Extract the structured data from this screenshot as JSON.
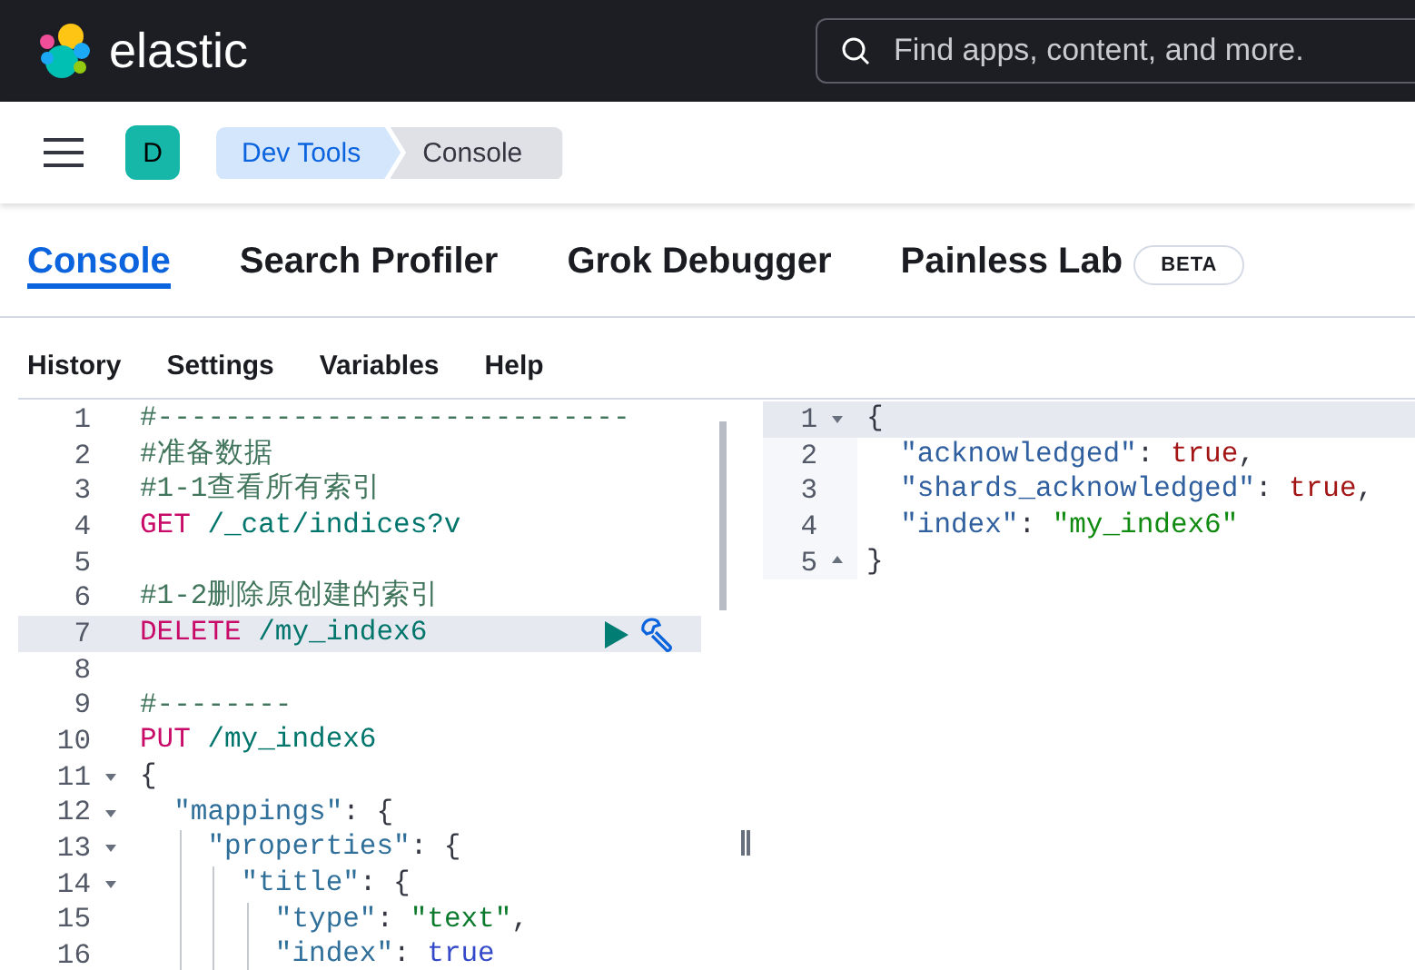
{
  "header": {
    "brand": "elastic",
    "search": {
      "placeholder": "Find apps, content, and more."
    }
  },
  "breadcrumb_bar": {
    "avatar": "D",
    "breadcrumbs": [
      {
        "label": "Dev Tools",
        "selected": false
      },
      {
        "label": "Console",
        "selected": true
      }
    ]
  },
  "tabs": [
    {
      "label": "Console",
      "selected": true
    },
    {
      "label": "Search Profiler",
      "selected": false
    },
    {
      "label": "Grok Debugger",
      "selected": false
    },
    {
      "label": "Painless Lab",
      "selected": false,
      "badge": "BETA"
    }
  ],
  "menu": [
    "History",
    "Settings",
    "Variables",
    "Help"
  ],
  "editor": {
    "lines": [
      {
        "number": "1",
        "fold_start": false,
        "fold_end": false,
        "selected": false,
        "tokens": [
          {
            "kind": "comment",
            "text": "#----------------------------"
          }
        ]
      },
      {
        "number": "2",
        "fold_start": false,
        "fold_end": false,
        "selected": false,
        "tokens": [
          {
            "kind": "comment",
            "text": "#准备数据"
          }
        ]
      },
      {
        "number": "3",
        "fold_start": false,
        "fold_end": false,
        "selected": false,
        "tokens": [
          {
            "kind": "comment",
            "text": "#1-1查看所有索引"
          }
        ]
      },
      {
        "number": "4",
        "fold_start": false,
        "fold_end": false,
        "selected": false,
        "tokens": [
          {
            "kind": "method",
            "text": "GET"
          },
          {
            "kind": "path",
            "text": " /_cat/indices?v"
          }
        ]
      },
      {
        "number": "5",
        "fold_start": false,
        "fold_end": false,
        "selected": false
      },
      {
        "number": "6",
        "fold_start": false,
        "fold_end": false,
        "selected": false,
        "tokens": [
          {
            "kind": "comment",
            "text": "#1-2删除原创建的索引"
          }
        ]
      },
      {
        "number": "7",
        "fold_start": false,
        "fold_end": false,
        "selected": true,
        "tokens": [
          {
            "kind": "method",
            "text": "DELETE"
          },
          {
            "kind": "path",
            "text": " /my_index6"
          }
        ]
      },
      {
        "number": "8",
        "fold_start": false,
        "fold_end": false,
        "selected": false
      },
      {
        "number": "9",
        "fold_start": false,
        "fold_end": false,
        "selected": false,
        "tokens": [
          {
            "kind": "comment",
            "text": "#--------"
          }
        ]
      },
      {
        "number": "10",
        "fold_start": false,
        "fold_end": false,
        "selected": false,
        "tokens": [
          {
            "kind": "method",
            "text": "PUT"
          },
          {
            "kind": "path",
            "text": " /my_index6"
          }
        ]
      },
      {
        "number": "11",
        "fold_start": true,
        "fold_end": false,
        "selected": false,
        "tokens": [
          {
            "kind": "punct",
            "text": "{"
          }
        ]
      },
      {
        "number": "12",
        "fold_start": true,
        "fold_end": false,
        "selected": false,
        "tokens": [
          {
            "kind": "key",
            "text": "  \"mappings\""
          },
          {
            "kind": "punct",
            "text": ": {"
          }
        ]
      },
      {
        "number": "13",
        "fold_start": true,
        "fold_end": false,
        "selected": false,
        "tokens": [
          {
            "kind": "key",
            "text": "    \"properties\""
          },
          {
            "kind": "punct",
            "text": ": {"
          }
        ]
      },
      {
        "number": "14",
        "fold_start": true,
        "fold_end": false,
        "selected": false,
        "tokens": [
          {
            "kind": "key",
            "text": "      \"title\""
          },
          {
            "kind": "punct",
            "text": ": {"
          }
        ]
      },
      {
        "number": "15",
        "fold_start": false,
        "fold_end": false,
        "selected": false,
        "tokens": [
          {
            "kind": "key",
            "text": "        \"type\""
          },
          {
            "kind": "punct",
            "text": ": "
          },
          {
            "kind": "string",
            "text": "\"text\""
          },
          {
            "kind": "punct",
            "text": ","
          }
        ]
      },
      {
        "number": "16",
        "fold_start": false,
        "fold_end": false,
        "selected": false,
        "tokens": [
          {
            "kind": "key",
            "text": "        \"index\""
          },
          {
            "kind": "punct",
            "text": ": "
          },
          {
            "kind": "bool",
            "text": "true"
          }
        ]
      }
    ]
  },
  "output": {
    "lines": [
      {
        "number": "1",
        "fold_start": true,
        "fold_end": false,
        "selected": true,
        "tokens": [
          {
            "kind": "punct",
            "text": "{"
          }
        ]
      },
      {
        "number": "2",
        "fold_start": false,
        "fold_end": false,
        "selected": false,
        "tokens": [
          {
            "kind": "key",
            "text": "  \"acknowledged\""
          },
          {
            "kind": "punct",
            "text": ": "
          },
          {
            "kind": "bool",
            "text": "true"
          },
          {
            "kind": "punct",
            "text": ","
          }
        ]
      },
      {
        "number": "3",
        "fold_start": false,
        "fold_end": false,
        "selected": false,
        "tokens": [
          {
            "kind": "key",
            "text": "  \"shards_acknowledged\""
          },
          {
            "kind": "punct",
            "text": ": "
          },
          {
            "kind": "bool",
            "text": "true"
          },
          {
            "kind": "punct",
            "text": ","
          }
        ]
      },
      {
        "number": "4",
        "fold_start": false,
        "fold_end": false,
        "selected": false,
        "tokens": [
          {
            "kind": "key",
            "text": "  \"index\""
          },
          {
            "kind": "punct",
            "text": ": "
          },
          {
            "kind": "string",
            "text": "\"my_index6\""
          }
        ]
      },
      {
        "number": "5",
        "fold_start": false,
        "fold_end": true,
        "selected": false,
        "tokens": [
          {
            "kind": "punct",
            "text": "}"
          }
        ]
      }
    ]
  }
}
